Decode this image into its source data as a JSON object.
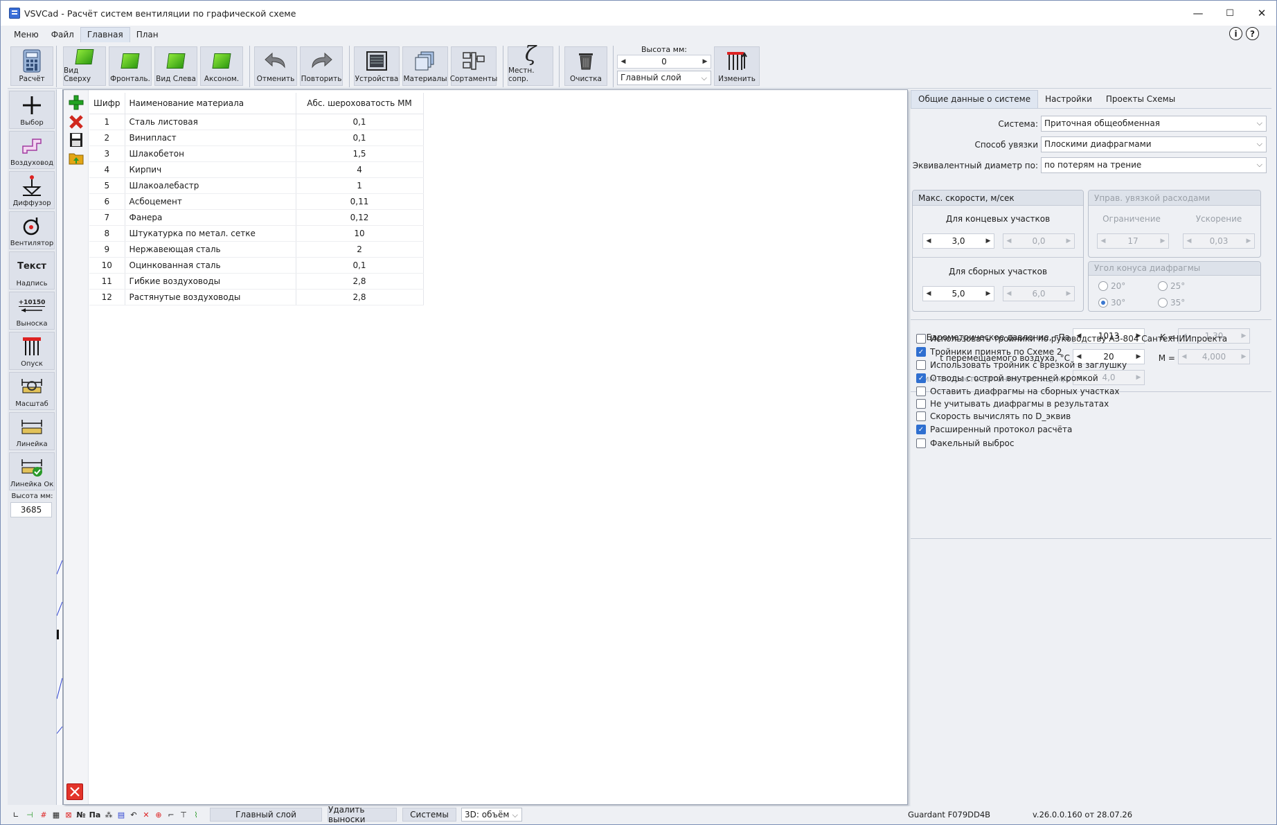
{
  "app": {
    "title": "VSVCad - Расчёт систем вентиляции по графической схеме"
  },
  "window_controls": {
    "minimize": "—",
    "maximize": "☐",
    "close": "✕"
  },
  "menu": [
    "Меню",
    "Файл",
    "Главная",
    "План"
  ],
  "ribbon": {
    "calc": "Расчёт",
    "top": "Вид Сверху",
    "front": "Фронталь.",
    "left": "Вид Слева",
    "axon": "Аксоном.",
    "undo": "Отменить",
    "redo": "Повторить",
    "devices": "Устройства",
    "materials": "Материалы",
    "assort": "Сортаменты",
    "local": "Местн. сопр.",
    "clean": "Очистка",
    "height_label": "Высота мм:",
    "height_value": "0",
    "layer": "Главный слой",
    "change": "Изменить"
  },
  "left_tools": {
    "select": "Выбор",
    "duct": "Воздуховод",
    "diffuser": "Диффузор",
    "fan": "Вентилятор",
    "text_icon": "Текст",
    "label": "Надпись",
    "leader_icon": "+10150",
    "leader": "Выноска",
    "drop": "Опуск",
    "scale": "Масштаб",
    "ruler": "Линейка",
    "ruler_ok": "Линейка Ок",
    "height_label": "Высота мм:",
    "height_value": "3685"
  },
  "table": {
    "headers": [
      "Шифр",
      "Наименование материала",
      "Абс. шероховатость ММ"
    ],
    "rows": [
      [
        "1",
        "Сталь листовая",
        "0,1"
      ],
      [
        "2",
        "Винипласт",
        "0,1"
      ],
      [
        "3",
        "Шлакобетон",
        "1,5"
      ],
      [
        "4",
        "Кирпич",
        "4"
      ],
      [
        "5",
        "Шлакоалебастр",
        "1"
      ],
      [
        "6",
        "Асбоцемент",
        "0,11"
      ],
      [
        "7",
        "Фанера",
        "0,12"
      ],
      [
        "8",
        "Штукатурка по метал. сетке",
        "10"
      ],
      [
        "9",
        "Нержавеющая сталь",
        "2"
      ],
      [
        "10",
        "Оцинкованная сталь",
        "0,1"
      ],
      [
        "11",
        "Гибкие воздуховоды",
        "2,8"
      ],
      [
        "12",
        "Растянутые воздуховоды",
        "2,8"
      ]
    ]
  },
  "right": {
    "tabs": [
      "Общие данные о системе",
      "Настройки",
      "Проекты Схемы"
    ],
    "system_label": "Система:",
    "system_value": "Приточная общеобменная",
    "link_label": "Способ увязки",
    "link_value": "Плоскими диафрагмами",
    "eqdiam_label": "Эквивалентный диаметр по:",
    "eqdiam_value": "по потерям на трение",
    "speeds_title": "Макс. скорости, м/сек",
    "end_sections": "Для концевых участков",
    "end_val": "3,0",
    "end_val2": "0,0",
    "collect_sections": "Для сборных участков",
    "collect_val": "5,0",
    "collect_val2": "6,0",
    "flow_title": "Управ. увязкой расходами",
    "limit": "Ограничение",
    "accel": "Ускорение",
    "limit_val": "17",
    "accel_val": "0,03",
    "cone_title": "Угол конуса диафрагмы",
    "a20": "20°",
    "a25": "25°",
    "a30": "30°",
    "a35": "35°",
    "baro_label": "Барометрическое давление, гПа",
    "baro_val": "1013",
    "k_label": "K =",
    "k_val": "1,30",
    "temp_label": "t перемещаемого воздуха, °C",
    "temp_val": "20",
    "m_label": "M =",
    "m_val": "4,000",
    "minspeed_label": "Мин. скорость витания частиц, м/с",
    "minspeed_val": "4,0",
    "checks": [
      {
        "label": "Использовать тройники по руководству А3-804 СантехНИИпроекта",
        "on": false
      },
      {
        "label": "Тройники принять по Схеме 2",
        "on": true
      },
      {
        "label": "Использовать тройник с врезкой в заглушку",
        "on": false
      },
      {
        "label": "Отводы с острой внутренней кромкой",
        "on": true
      },
      {
        "label": "Оставить диафрагмы на сборных участках",
        "on": false
      },
      {
        "label": "Не учитывать диафрагмы в результатах",
        "on": false
      },
      {
        "label": "Скорость вычислять по D_эквив",
        "on": false
      },
      {
        "label": "Расширенный протокол расчёта",
        "on": true
      },
      {
        "label": "Факельный выброс",
        "on": false
      }
    ]
  },
  "status": {
    "no": "№",
    "pa": "Па",
    "layer": "Главный слой",
    "del": "Удалить выноски",
    "systems": "Системы",
    "view": "3D: объём",
    "guardant": "Guardant F079DD4B",
    "version": "v.26.0.0.160 от 28.07.26"
  }
}
